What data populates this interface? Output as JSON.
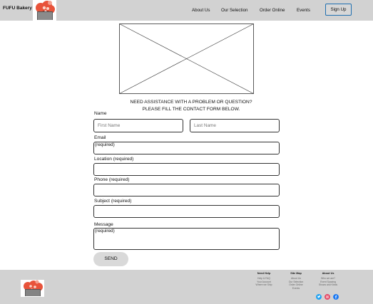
{
  "header": {
    "brand": "FUFU Bakery",
    "nav": [
      "About Us",
      "Our Selection",
      "Order Online",
      "Events"
    ],
    "signup_label": "Sign Up"
  },
  "form": {
    "intro_line1": "NEED ASSISTANCE WITH A PROBLEM OR QUESTION?",
    "intro_line2": "PLEASE FILL THE CONTACT FORM BELOW.",
    "name_label": "Name",
    "first_name_placeholder": "First Name",
    "last_name_placeholder": "Last Name",
    "email_label": "Email",
    "email_hint": "(required)",
    "location_label": "Location (required)",
    "phone_label": "Phone (required)",
    "subject_label": "Subject (required)",
    "message_label": "Message",
    "message_hint": "(required)",
    "send_label": "SEND"
  },
  "footer": {
    "columns": [
      {
        "heading": "Need Help",
        "links": [
          "Help & FAQ",
          "Your Account",
          "Where we Ship"
        ]
      },
      {
        "heading": "Site Map",
        "links": [
          "About Us",
          "Our Selection",
          "Order Online",
          "Events"
        ]
      },
      {
        "heading": "About Us",
        "links": [
          "Who we are?",
          "Event Spacing",
          "Shows and Kinds"
        ]
      }
    ],
    "socials": [
      "twitter-icon",
      "instagram-icon",
      "facebook-icon"
    ]
  },
  "colors": {
    "bar": "#d2d2d2",
    "accent": "#1f6fb0",
    "logo_orange": "#e8533a",
    "twitter": "#1da1f2",
    "instagram": "#e4405f",
    "facebook": "#1877f2"
  }
}
